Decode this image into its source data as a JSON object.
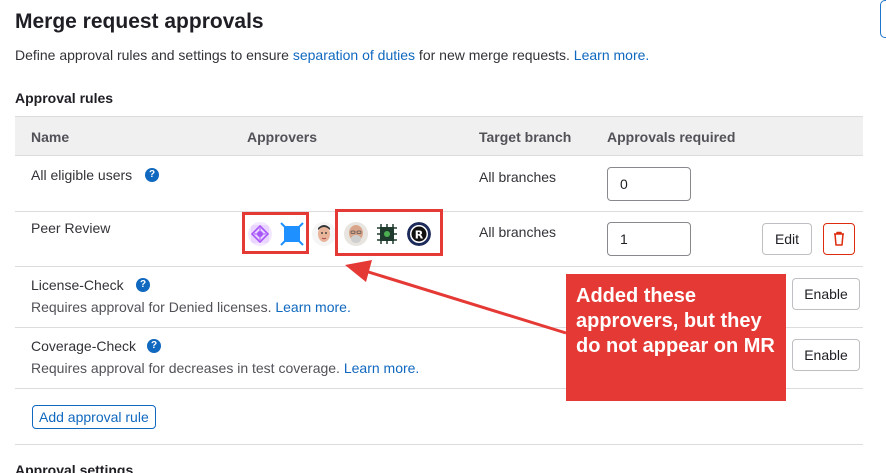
{
  "page": {
    "title": "Merge request approvals",
    "description_pre": "Define approval rules and settings to ensure ",
    "description_link": "separation of duties",
    "description_mid": " for new merge requests. ",
    "description_learn_more": "Learn more."
  },
  "approval_rules": {
    "section_title": "Approval rules",
    "columns": {
      "name": "Name",
      "approvers": "Approvers",
      "target_branch": "Target branch",
      "approvals_required": "Approvals required"
    },
    "rows": [
      {
        "name": "All eligible users",
        "help": "?",
        "target_branch": "All branches",
        "approvals_required": "0"
      },
      {
        "name": "Peer Review",
        "target_branch": "All branches",
        "approvals_required": "1",
        "edit_label": "Edit",
        "approvers": [
          "group-avatar-purple",
          "group-avatar-blue",
          "user-avatar-face",
          "user-avatar-bald",
          "user-avatar-green",
          "user-avatar-r"
        ]
      },
      {
        "name": "License-Check",
        "help": "?",
        "subtext": "Requires approval for Denied licenses. ",
        "learn_more": "Learn more.",
        "action_label": "Enable"
      },
      {
        "name": "Coverage-Check",
        "help": "?",
        "subtext": "Requires approval for decreases in test coverage. ",
        "learn_more": "Learn more.",
        "action_label": "Enable"
      }
    ],
    "add_rule_label": "Add approval rule"
  },
  "annotation": {
    "callout_text": "Added these approvers, but they do not appear on MR",
    "color": "#e53935"
  },
  "next_section_title": "Approval settings",
  "colors": {
    "link": "#1068bf",
    "danger": "#dd2b0e",
    "header_bg": "#f0f0f0"
  }
}
